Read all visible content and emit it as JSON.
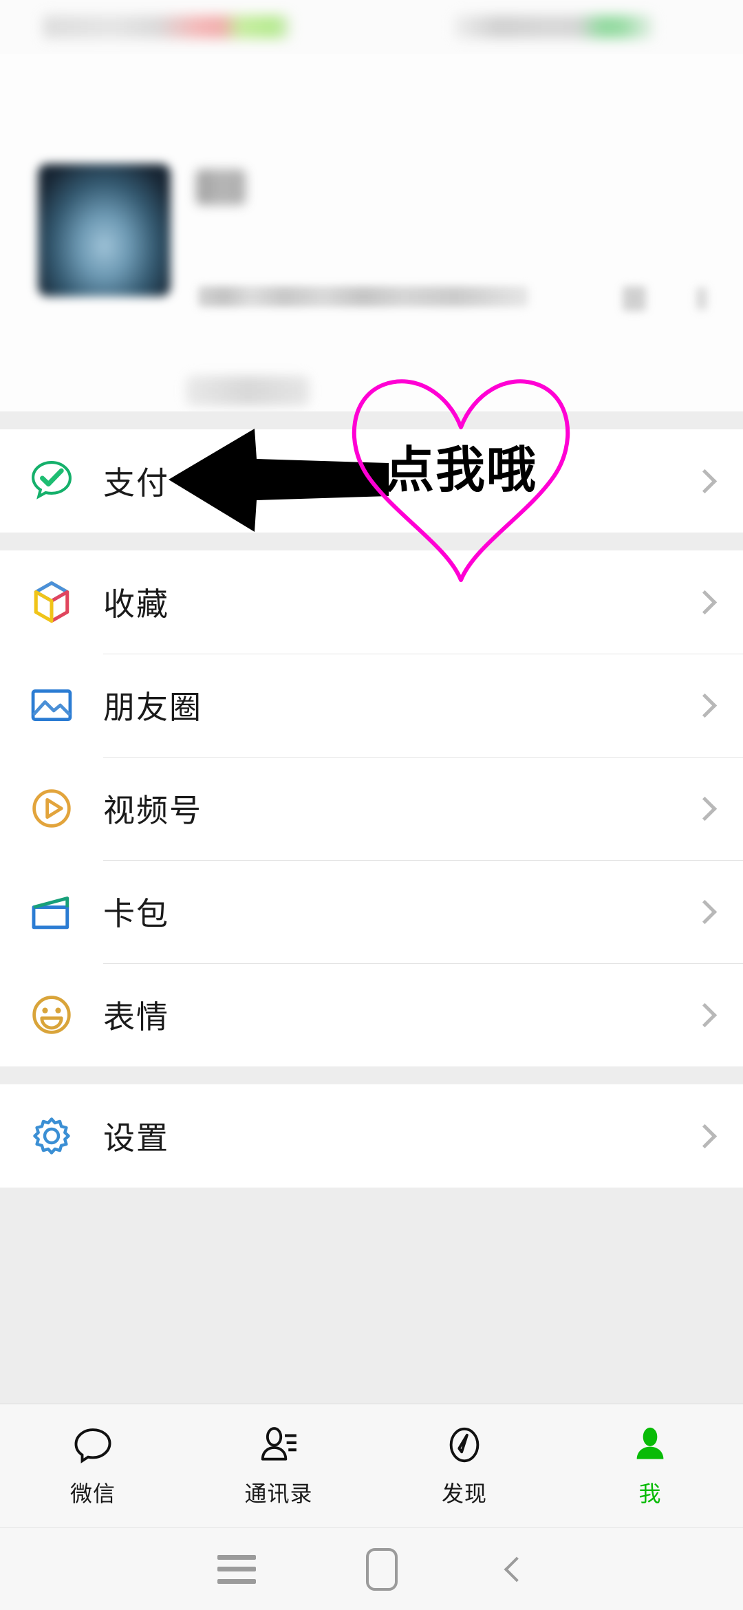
{
  "app": {
    "name": "WeChat",
    "screen": "Me",
    "accent_color": "#09bb07"
  },
  "statusbar": {
    "blurred": "true"
  },
  "profile": {
    "name_blurred": "true",
    "wxid_blurred": "true",
    "avatar_blurred": "true"
  },
  "menu_groups": [
    {
      "items": [
        {
          "label": "支付",
          "icon": "pay-icon",
          "color": "#22b573",
          "chevron": "chevron-right-icon"
        }
      ]
    },
    {
      "items": [
        {
          "label": "收藏",
          "icon": "favorites-cube-icon",
          "color": "#4a90d9",
          "chevron": "chevron-right-icon"
        },
        {
          "label": "朋友圈",
          "icon": "moments-photo-icon",
          "color": "#2b7cd3",
          "chevron": "chevron-right-icon"
        },
        {
          "label": "视频号",
          "icon": "channels-play-icon",
          "color": "#e2a43c",
          "chevron": "chevron-right-icon"
        },
        {
          "label": "卡包",
          "icon": "cards-wallet-icon",
          "color": "#2b7cd3",
          "chevron": "chevron-right-icon"
        },
        {
          "label": "表情",
          "icon": "stickers-smiley-icon",
          "color": "#d9a43a",
          "chevron": "chevron-right-icon"
        }
      ]
    },
    {
      "items": [
        {
          "label": "设置",
          "icon": "settings-gear-icon",
          "color": "#3b8fd4",
          "chevron": "chevron-right-icon"
        }
      ]
    }
  ],
  "annotations": {
    "arrow": {
      "icon": "left-arrow-annotation",
      "color": "#000000"
    },
    "heart": {
      "icon": "heart-outline-annotation",
      "color": "#ff00d4",
      "text": "点我哦"
    }
  },
  "tabbar": {
    "tabs": [
      {
        "label": "微信",
        "icon": "chat-bubble-icon",
        "active": false
      },
      {
        "label": "通讯录",
        "icon": "contacts-icon",
        "active": false
      },
      {
        "label": "发现",
        "icon": "compass-discover-icon",
        "active": false
      },
      {
        "label": "我",
        "icon": "person-me-icon",
        "active": true
      }
    ]
  },
  "navbar": {
    "buttons": [
      {
        "icon": "recents-icon"
      },
      {
        "icon": "home-icon"
      },
      {
        "icon": "back-icon"
      }
    ]
  }
}
